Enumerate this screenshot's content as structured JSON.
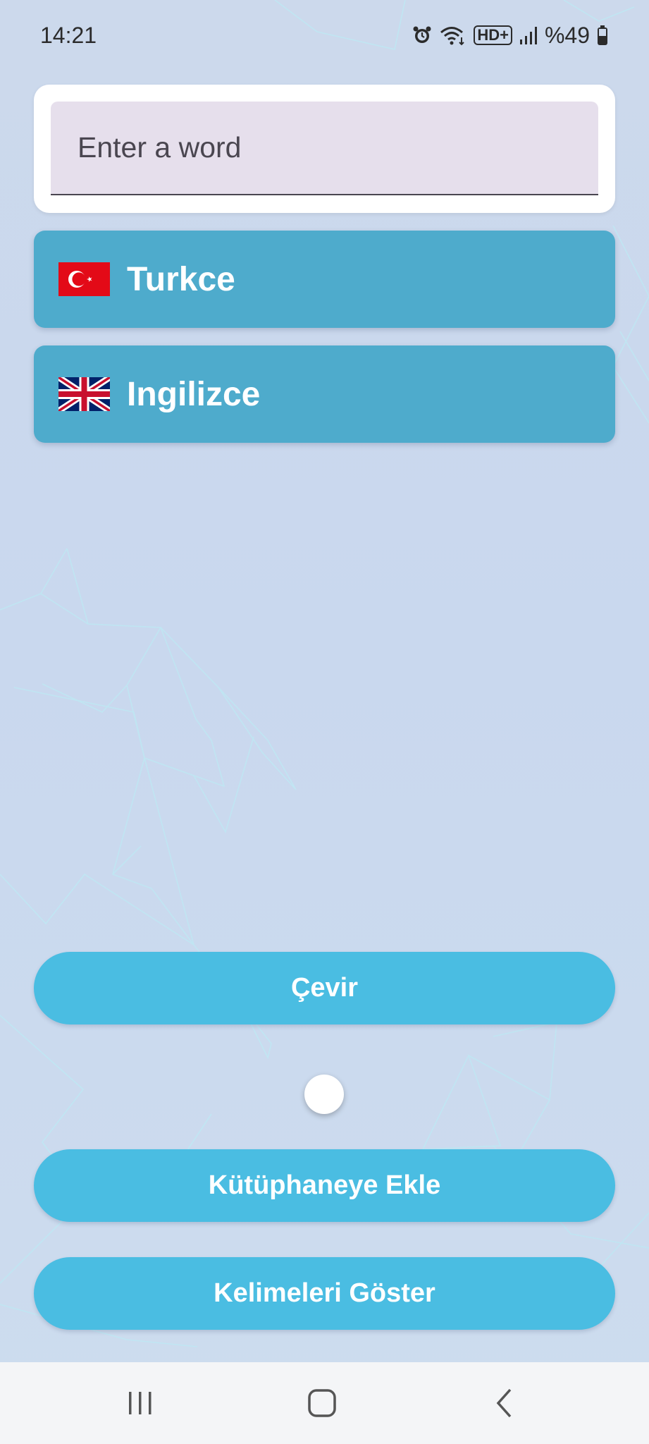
{
  "status_bar": {
    "time": "14:21",
    "battery_text": "%49",
    "network_label": "HD+",
    "icons": [
      "alarm-icon",
      "wifi-icon",
      "hd-plus-icon",
      "signal-icon",
      "battery-icon"
    ]
  },
  "search": {
    "placeholder": "Enter a word",
    "value": ""
  },
  "languages": [
    {
      "label": "Turkce",
      "flag": "turkey-flag-icon"
    },
    {
      "label": "Ingilizce",
      "flag": "uk-flag-icon"
    }
  ],
  "actions": {
    "translate_label": "Çevir",
    "add_library_label": "Kütüphaneye Ekle",
    "show_words_label": "Kelimeleri Göster"
  },
  "nav": {
    "icons": [
      "recent-apps-icon",
      "home-icon",
      "back-icon"
    ]
  },
  "colors": {
    "language_row": "#4eabcc",
    "button": "#4abde2",
    "input_bg": "#e6dfec",
    "background": "#ccd9ec",
    "turkey_red": "#e30a17",
    "uk_blue": "#012169",
    "uk_red": "#c8102e"
  }
}
